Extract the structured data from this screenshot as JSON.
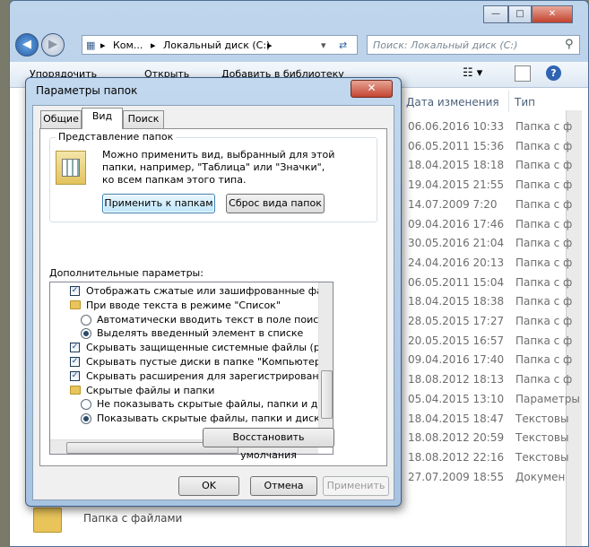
{
  "explorer": {
    "address_parts": [
      "Ком...",
      "Локальный диск (C:)"
    ],
    "search_placeholder": "Поиск: Локальный диск (C:)",
    "toolbar": {
      "organize": "Упорядочить",
      "open": "Открыть",
      "add_library": "Добавить в библиотеку"
    },
    "columns": {
      "date": "Дата изменения",
      "type": "Тип"
    },
    "rows": [
      {
        "date": "06.06.2016 10:33",
        "type": "Папка с ф"
      },
      {
        "date": "06.05.2011 15:36",
        "type": "Папка с ф"
      },
      {
        "date": "18.04.2015 18:18",
        "type": "Папка с ф"
      },
      {
        "date": "19.04.2015 21:55",
        "type": "Папка с ф"
      },
      {
        "date": "14.07.2009 7:20",
        "type": "Папка с ф"
      },
      {
        "date": "09.04.2016 17:46",
        "type": "Папка с ф"
      },
      {
        "date": "30.05.2016 21:04",
        "type": "Папка с ф"
      },
      {
        "date": "24.04.2016 20:13",
        "type": "Папка с ф"
      },
      {
        "date": "06.05.2011 15:04",
        "type": "Папка с ф"
      },
      {
        "date": "18.04.2015 18:38",
        "type": "Папка с ф"
      },
      {
        "date": "28.05.2015 17:27",
        "type": "Папка с ф"
      },
      {
        "date": "20.05.2015 16:57",
        "type": "Папка с ф"
      },
      {
        "date": "09.04.2016 17:40",
        "type": "Папка с ф"
      },
      {
        "date": "18.08.2012 18:13",
        "type": "Папка с ф"
      },
      {
        "date": "05.04.2015 13:10",
        "type": "Параметры"
      },
      {
        "date": "18.04.2015 18:47",
        "type": "Текстовы"
      },
      {
        "date": "18.08.2012 20:59",
        "type": "Текстовы"
      },
      {
        "date": "18.08.2012 22:16",
        "type": "Текстовы"
      },
      {
        "date": "27.07.2009 18:55",
        "type": "Докумен"
      }
    ],
    "status": "Папка с файлами"
  },
  "dialog": {
    "title": "Параметры папок",
    "close": "✕",
    "tabs": [
      "Общие",
      "Вид",
      "Поиск"
    ],
    "group_title": "Представление папок",
    "group_text": [
      "Можно применить вид, выбранный для этой",
      "папки, например, \"Таблица\" или \"Значки\",",
      "ко всем папкам этого типа."
    ],
    "apply_to_folders": "Применить к папкам",
    "reset_folders": "Сброс вида папок",
    "advanced_label": "Дополнительные параметры:",
    "tree": [
      {
        "kind": "check",
        "checked": true,
        "label": "Отображать сжатые или зашифрованные файлы NTFS"
      },
      {
        "kind": "folder",
        "label": "При вводе текста в режиме \"Список\""
      },
      {
        "kind": "radio",
        "checked": false,
        "label": "Автоматически вводить текст в поле поиска"
      },
      {
        "kind": "radio",
        "checked": true,
        "label": "Выделять введенный элемент в списке"
      },
      {
        "kind": "check",
        "checked": true,
        "label": "Скрывать защищенные системные файлы (рекомендуется)"
      },
      {
        "kind": "check",
        "checked": true,
        "label": "Скрывать пустые диски в папке \"Компьютер\""
      },
      {
        "kind": "check",
        "checked": true,
        "label": "Скрывать расширения для зарегистрированных типов файлов"
      },
      {
        "kind": "folder",
        "label": "Скрытые файлы и папки"
      },
      {
        "kind": "radio",
        "checked": false,
        "label": "Не показывать скрытые файлы, папки и диски"
      },
      {
        "kind": "radio",
        "checked": true,
        "label": "Показывать скрытые файлы, папки и диски"
      }
    ],
    "restore_defaults": "Восстановить умолчания",
    "ok": "OK",
    "cancel": "Отмена",
    "apply": "Применить"
  }
}
